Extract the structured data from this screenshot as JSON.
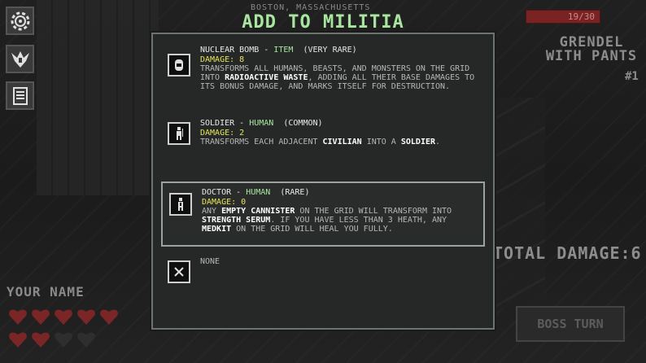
{
  "background": {
    "city_label": "BOSTON, MASSACHUSETTS",
    "health": "19/30",
    "enemy_name": "GRENDEL WITH PANTS",
    "enemy_rank": "#1",
    "total_damage": "TOTAL DAMAGE:6",
    "boss_turn_label": "BOSS TURN",
    "player_name": "YOUR NAME",
    "hearts": [
      {
        "state": "full"
      },
      {
        "state": "full"
      },
      {
        "state": "full"
      },
      {
        "state": "full"
      },
      {
        "state": "full"
      },
      {
        "state": "full"
      },
      {
        "state": "full"
      },
      {
        "state": "empty"
      },
      {
        "state": "empty"
      }
    ],
    "side_icons": [
      "gear-icon",
      "crest-icon",
      "document-icon"
    ]
  },
  "modal": {
    "title": "ADD TO MILITIA",
    "options": [
      {
        "name": "NUCLEAR BOMB",
        "sep": " - ",
        "type": "ITEM",
        "rarity": "(VERY RARE)",
        "damage": "DAMAGE: 8",
        "desc_parts": [
          {
            "t": "TRANSFORMS ALL HUMANS, BEASTS, AND MONSTERS ON THE GRID INTO ",
            "hl": false
          },
          {
            "t": "RADIOACTIVE WASTE",
            "hl": true
          },
          {
            "t": ", ADDING ALL THEIR BASE DAMAGES TO ITS BONUS DAMAGE, AND MARKS ITSELF FOR DESTRUCTION.",
            "hl": false
          }
        ],
        "icon": "bomb-icon",
        "selected": false
      },
      {
        "name": "SOLDIER",
        "sep": " - ",
        "type": "HUMAN",
        "rarity": "(COMMON)",
        "damage": "DAMAGE: 2",
        "desc_parts": [
          {
            "t": "TRANSFORMS EACH ADJACENT ",
            "hl": false
          },
          {
            "t": "CIVILIAN",
            "hl": true
          },
          {
            "t": " INTO A ",
            "hl": false
          },
          {
            "t": "SOLDIER",
            "hl": true
          },
          {
            "t": ".",
            "hl": false
          }
        ],
        "icon": "soldier-icon",
        "selected": false
      },
      {
        "name": "DOCTOR",
        "sep": " - ",
        "type": "HUMAN",
        "rarity": "(RARE)",
        "damage": "DAMAGE: 0",
        "desc_parts": [
          {
            "t": "ANY ",
            "hl": false
          },
          {
            "t": "EMPTY CANNISTER",
            "hl": true
          },
          {
            "t": " ON THE GRID WILL TRANSFORM INTO ",
            "hl": false
          },
          {
            "t": "STRENGTH SERUM",
            "hl": true
          },
          {
            "t": ". IF YOU HAVE LESS THAN 3 HEATH, ANY ",
            "hl": false
          },
          {
            "t": "MEDKIT",
            "hl": true
          },
          {
            "t": " ON THE GRID WILL HEAL YOU FULLY.",
            "hl": false
          }
        ],
        "icon": "doctor-icon",
        "selected": true
      },
      {
        "name": "NONE",
        "icon": "close-icon",
        "selected": false
      }
    ]
  }
}
